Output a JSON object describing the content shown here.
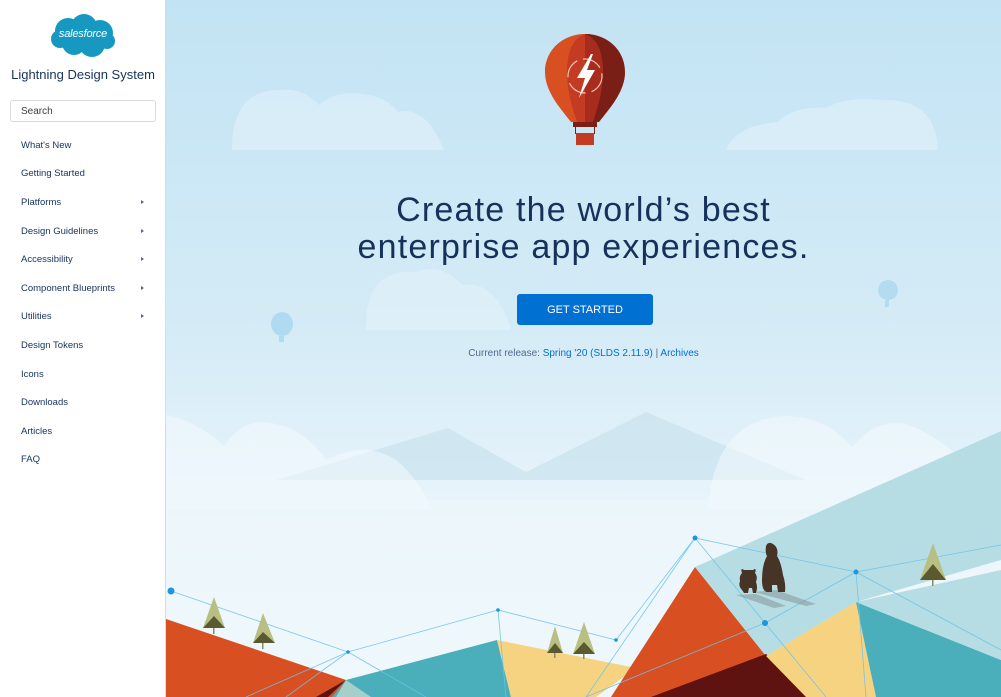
{
  "sidebar": {
    "logo": {
      "text": "salesforce",
      "color": "#1798c1"
    },
    "product_title": "Lightning Design System",
    "search": {
      "placeholder": "Search",
      "value": ""
    },
    "items": [
      {
        "label": "What's New",
        "has_children": false
      },
      {
        "label": "Getting Started",
        "has_children": false
      },
      {
        "label": "Platforms",
        "has_children": true
      },
      {
        "label": "Design Guidelines",
        "has_children": true
      },
      {
        "label": "Accessibility",
        "has_children": true
      },
      {
        "label": "Component Blueprints",
        "has_children": true
      },
      {
        "label": "Utilities",
        "has_children": true
      },
      {
        "label": "Design Tokens",
        "has_children": false
      },
      {
        "label": "Icons",
        "has_children": false
      },
      {
        "label": "Downloads",
        "has_children": false
      },
      {
        "label": "Articles",
        "has_children": false
      },
      {
        "label": "FAQ",
        "has_children": false
      }
    ]
  },
  "hero": {
    "title_line1": "Create the world’s best",
    "title_line2": "enterprise app experiences.",
    "cta_label": "GET STARTED",
    "release_prefix": "Current release: ",
    "release_link": "Spring '20 (SLDS 2.11.9)",
    "separator": " | ",
    "archives_link": "Archives"
  },
  "colors": {
    "accent": "#0070d2",
    "text_primary": "#16325c",
    "text_muted": "#54698d",
    "balloon": "#c23934",
    "mountain_orange": "#d84f21",
    "mountain_teal": "#4aaebb",
    "mountain_yellow": "#f5d381",
    "mountain_light": "#b5dde3",
    "mountain_dark": "#5e1310"
  }
}
